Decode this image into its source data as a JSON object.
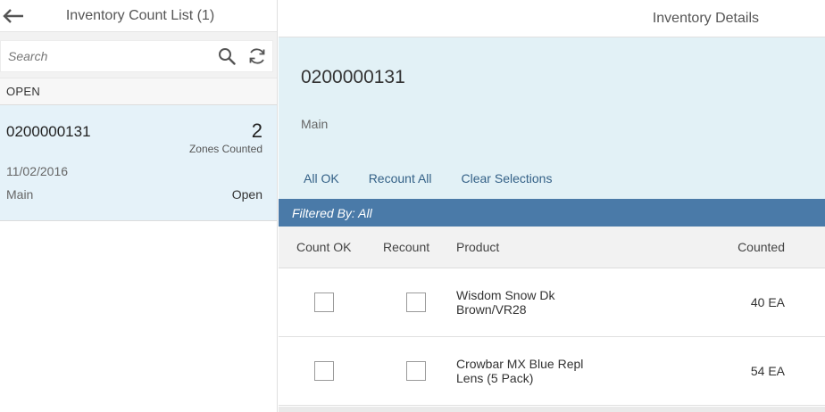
{
  "master": {
    "title": "Inventory Count List (1)",
    "search_placeholder": "Search",
    "group_label": "OPEN",
    "items": [
      {
        "number": "0200000131",
        "count": "2",
        "count_label": "Zones Counted",
        "date": "11/02/2016",
        "location": "Main",
        "status": "Open"
      }
    ]
  },
  "detail": {
    "title": "Inventory Details",
    "object_title": "0200000131",
    "object_subtitle": "Main",
    "actions": {
      "all_ok": "All OK",
      "recount_all": "Recount All",
      "clear_selections": "Clear Selections"
    },
    "filter_text": "Filtered By: All",
    "columns": {
      "count_ok": "Count OK",
      "recount": "Recount",
      "product": "Product",
      "counted": "Counted"
    },
    "rows": [
      {
        "product_line1": "Wisdom Snow Dk",
        "product_line2": "Brown/VR28",
        "counted": "40 EA",
        "count_ok": false,
        "recount": false
      },
      {
        "product_line1": "Crowbar MX Blue Repl",
        "product_line2": "Lens (5 Pack)",
        "counted": "54 EA",
        "count_ok": false,
        "recount": false
      }
    ]
  },
  "icons": {
    "back": "arrow-left-icon",
    "search": "search-icon",
    "refresh": "refresh-icon"
  },
  "colors": {
    "selected_item_bg": "#e5f2f9",
    "object_header_bg": "#e2f1f6",
    "filter_bar_bg": "#4a7aa8",
    "link": "#346187"
  }
}
